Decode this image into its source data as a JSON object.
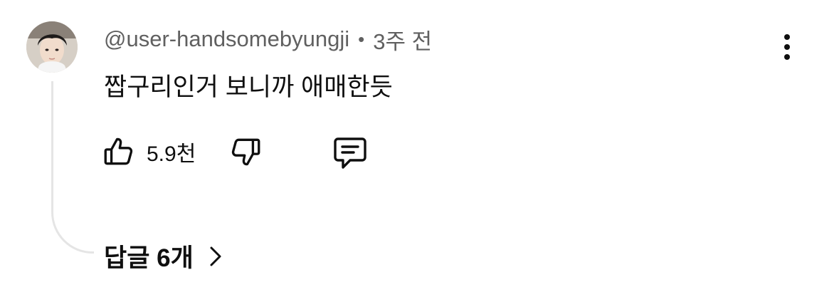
{
  "comment": {
    "author": "@user-handsomebyungji",
    "separator": "•",
    "time": "3주 전",
    "text": "짭구리인거 보니까 애매한듯",
    "likes": "5.9천",
    "replies_label": "답글 6개"
  },
  "icons": {
    "avatar": "user-avatar-photo",
    "more": "more-vertical-icon",
    "like": "thumbs-up-icon",
    "dislike": "thumbs-down-icon",
    "reply": "comment-icon",
    "chevron": "chevron-right-icon"
  },
  "colors": {
    "text_primary": "#0f0f0f",
    "text_secondary": "#606060",
    "thread_line": "#e5e5e5"
  }
}
